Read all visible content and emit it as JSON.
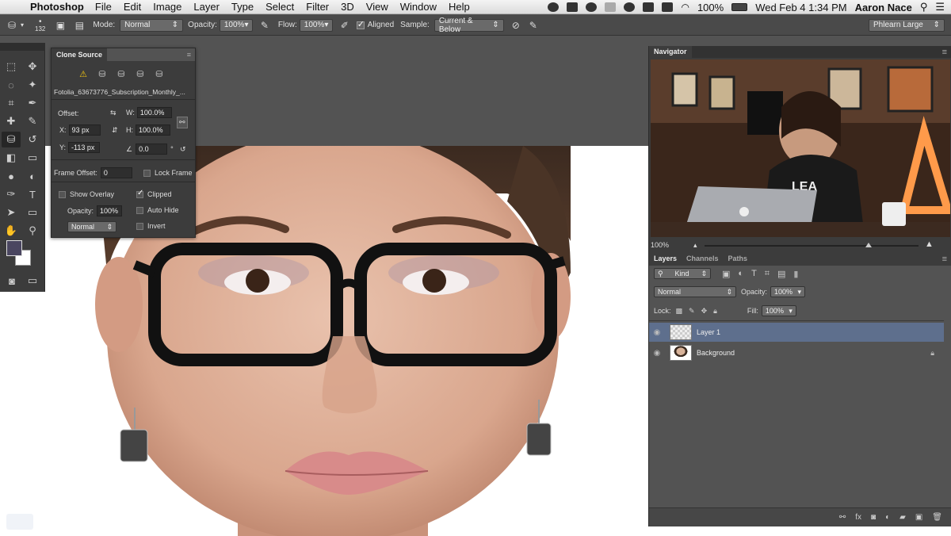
{
  "menubar": {
    "app_name": "Photoshop",
    "menus": [
      "File",
      "Edit",
      "Image",
      "Layer",
      "Type",
      "Select",
      "Filter",
      "3D",
      "View",
      "Window",
      "Help"
    ],
    "battery": "100%",
    "datetime": "Wed Feb 4  1:34 PM",
    "user": "Aaron Nace"
  },
  "options_bar": {
    "brush_size": "132",
    "mode_label": "Mode:",
    "mode_value": "Normal",
    "opacity_label": "Opacity:",
    "opacity_value": "100%",
    "flow_label": "Flow:",
    "flow_value": "100%",
    "aligned_label": "Aligned",
    "sample_label": "Sample:",
    "sample_value": "Current & Below",
    "workspace": "Phlearn Large"
  },
  "clone_source": {
    "title": "Clone Source",
    "filename": "Fotolia_63673776_Subscription_Monthly_...",
    "offset_label": "Offset:",
    "w_label": "W:",
    "w_value": "100.0%",
    "h_label": "H:",
    "h_value": "100.0%",
    "x_label": "X:",
    "x_value": "93 px",
    "y_label": "Y:",
    "y_value": "-113 px",
    "angle_value": "0.0",
    "degree": "°",
    "frame_offset_label": "Frame Offset:",
    "frame_offset_value": "0",
    "lock_frame_label": "Lock Frame",
    "show_overlay_label": "Show Overlay",
    "clipped_label": "Clipped",
    "opacity_label": "Opacity:",
    "opacity_value": "100%",
    "auto_hide_label": "Auto Hide",
    "blend_value": "Normal",
    "invert_label": "Invert"
  },
  "navigator": {
    "title": "Navigator",
    "zoom": "100%"
  },
  "layers": {
    "tabs": [
      "Layers",
      "Channels",
      "Paths"
    ],
    "kind_label": "Kind",
    "blend_mode": "Normal",
    "opacity_label": "Opacity:",
    "opacity_value": "100%",
    "lock_label": "Lock:",
    "fill_label": "Fill:",
    "fill_value": "100%",
    "items": [
      {
        "name": "Layer 1",
        "selected": true
      },
      {
        "name": "Background",
        "selected": false
      }
    ]
  }
}
